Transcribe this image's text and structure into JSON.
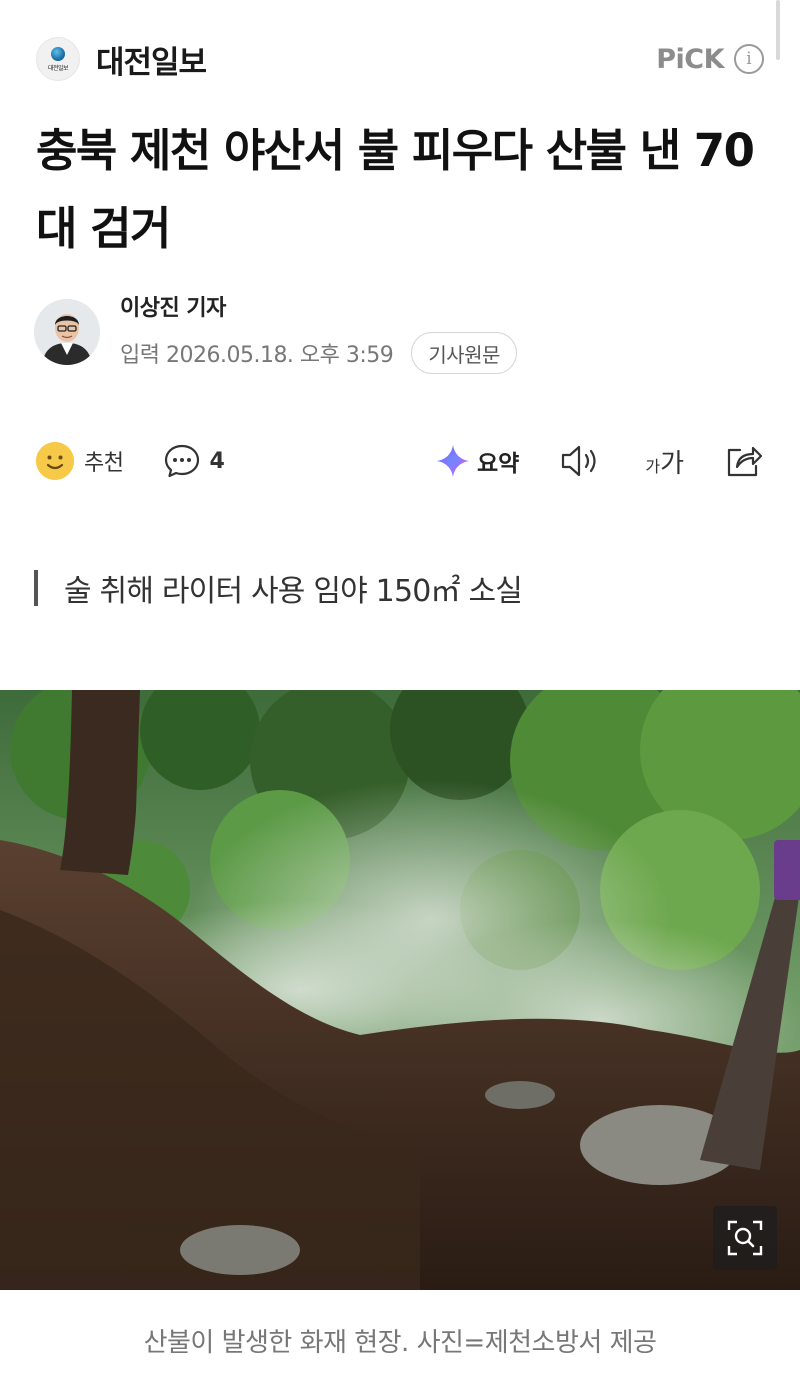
{
  "header": {
    "press_name": "대전일보",
    "press_logo_text": "대전일보",
    "pick_label": "PiCK"
  },
  "article": {
    "title": "충북 제천 야산서 불 피우다 산불 낸 70대 검거",
    "reporter": "이상진 기자",
    "date": "입력 2026.05.18. 오후 3:59",
    "original_button": "기사원문",
    "subtitle": "술 취해 라이터 사용 임야 150㎡ 소실",
    "caption": "산불이 발생한 화재 현장. 사진=제천소방서 제공"
  },
  "actions": {
    "recommend_label": "추천",
    "comment_count": "4",
    "summary_label": "요약",
    "font_small": "가",
    "font_big": "가"
  },
  "icons": {
    "press_logo": "globe-icon",
    "info": "info-icon",
    "recommend": "smile-icon",
    "comment": "speech-bubble-icon",
    "summary": "sparkle-icon",
    "tts": "speaker-icon",
    "font_size": "font-size-icon",
    "share": "share-icon",
    "zoom": "zoom-icon"
  },
  "colors": {
    "smile": "#f7c948",
    "summary_gradient_start": "#4f7cff",
    "summary_gradient_end": "#c86bff"
  }
}
